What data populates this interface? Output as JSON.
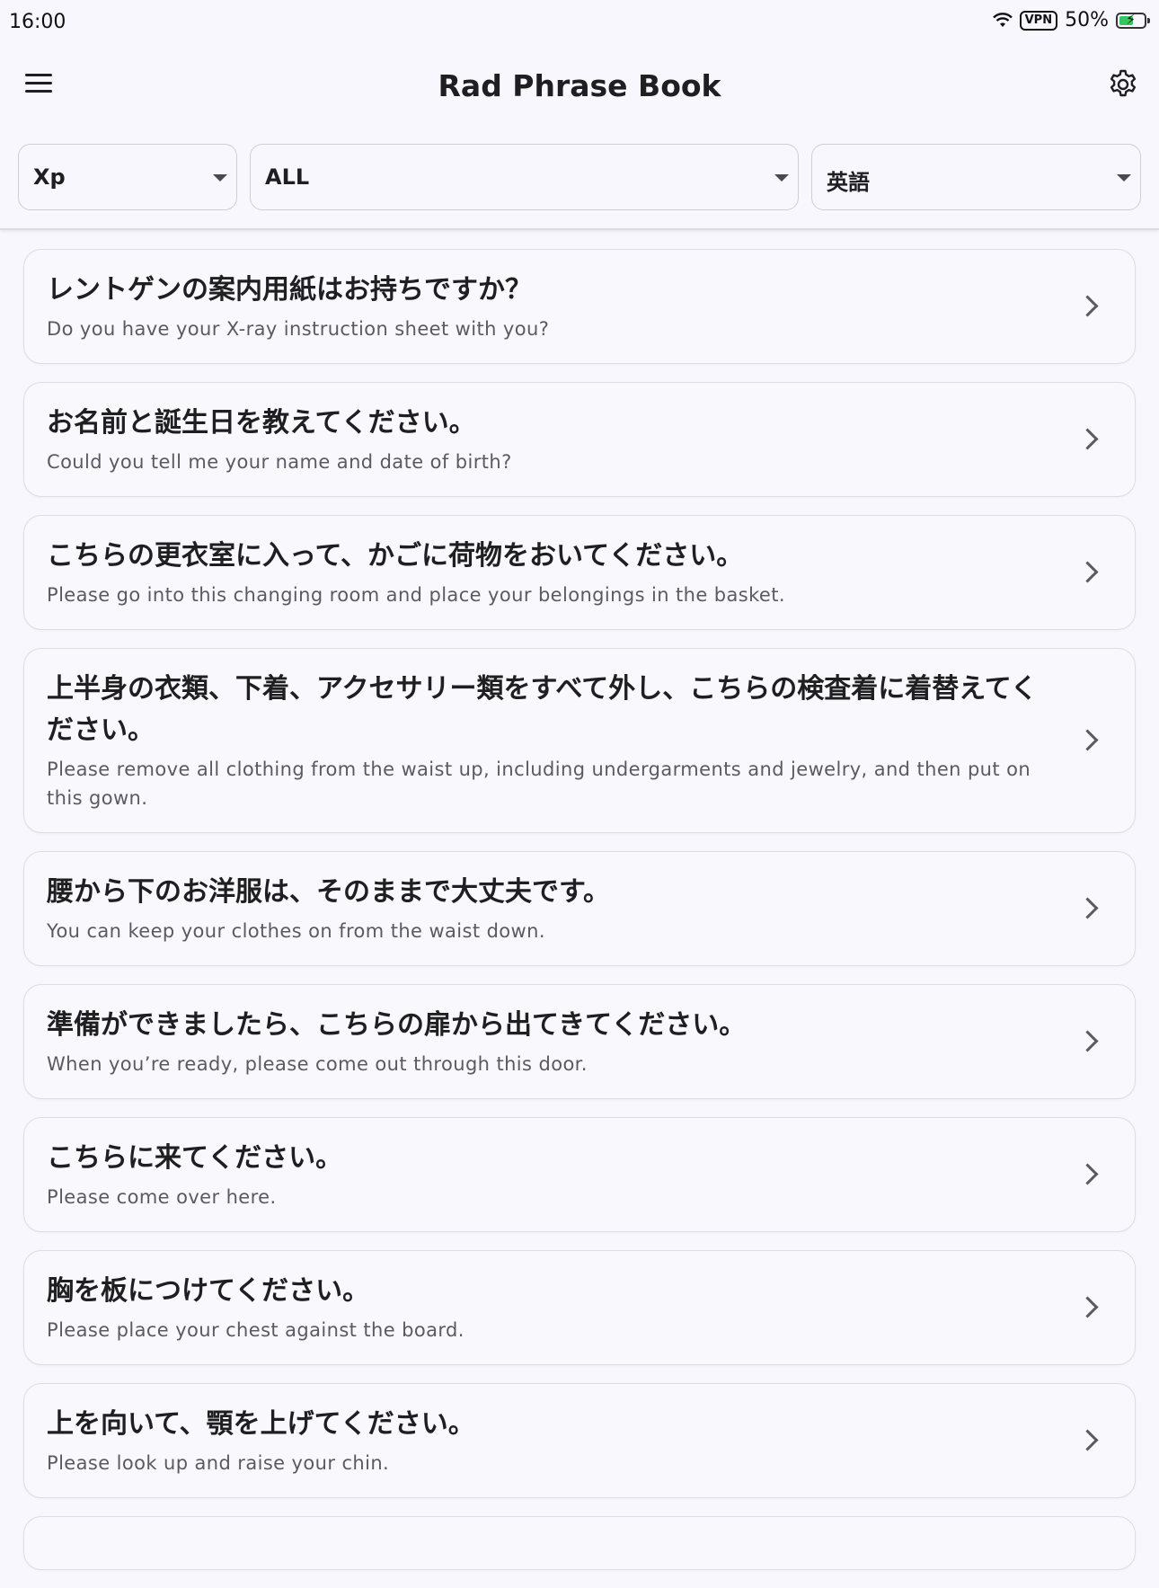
{
  "status_bar": {
    "time": "16:00",
    "vpn": "VPN",
    "battery": "50%"
  },
  "app_bar": {
    "title": "Rad Phrase Book"
  },
  "filters": {
    "modality": "Xp",
    "category": "ALL",
    "language": "英語"
  },
  "phrases": [
    {
      "ja": "レントゲンの案内用紙はお持ちですか？",
      "en": "Do you have your X-ray instruction sheet with you?"
    },
    {
      "ja": "お名前と誕生日を教えてください。",
      "en": "Could you tell me your name and date of birth?"
    },
    {
      "ja": "こちらの更衣室に入って、かごに荷物をおいてください。",
      "en": "Please go into this changing room and place your belongings in the basket."
    },
    {
      "ja": "上半身の衣類、下着、アクセサリー類をすべて外し、こちらの検査着に着替えてください。",
      "en": "Please remove all clothing from the waist up, including undergarments and jewelry, and then put on this gown."
    },
    {
      "ja": "腰から下のお洋服は、そのままで大丈夫です。",
      "en": "You can keep your clothes on from the waist down."
    },
    {
      "ja": "準備ができましたら、こちらの扉から出てきてください。",
      "en": "When you’re ready, please come out through this door."
    },
    {
      "ja": "こちらに来てください。",
      "en": "Please come over here."
    },
    {
      "ja": "胸を板につけてください。",
      "en": "Please place your chest against the board."
    },
    {
      "ja": "上を向いて、顎を上げてください。",
      "en": "Please look up and raise your chin."
    }
  ],
  "colors": {
    "background": "#f8f7fd",
    "card_border": "#dedce6",
    "battery_accent": "#34c759"
  }
}
